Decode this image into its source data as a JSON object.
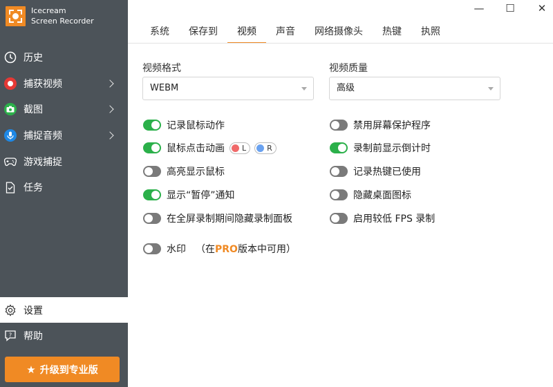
{
  "brand": {
    "line1": "Icecream",
    "line2": "Screen Recorder"
  },
  "sidebar": {
    "items": [
      {
        "label": "历史"
      },
      {
        "label": "捕获视频"
      },
      {
        "label": "截图"
      },
      {
        "label": "捕捉音频"
      },
      {
        "label": "游戏捕捉"
      },
      {
        "label": "任务"
      }
    ],
    "bottom": [
      {
        "label": "设置"
      },
      {
        "label": "帮助"
      }
    ],
    "upgrade_label": "升级到专业版"
  },
  "window": {
    "minimize": "—",
    "maximize": "☐",
    "close": "✕"
  },
  "tabs": [
    {
      "label": "系统"
    },
    {
      "label": "保存到"
    },
    {
      "label": "视频"
    },
    {
      "label": "声音"
    },
    {
      "label": "网络摄像头"
    },
    {
      "label": "热键"
    },
    {
      "label": "执照"
    }
  ],
  "video_format": {
    "label": "视频格式",
    "value": "WEBM"
  },
  "video_quality": {
    "label": "视频质量",
    "value": "高级"
  },
  "left_options": [
    {
      "label": "记录鼠标动作",
      "on": true
    },
    {
      "label": "鼠标点击动画",
      "on": true,
      "left_key": "L",
      "right_key": "R"
    },
    {
      "label": "高亮显示鼠标",
      "on": false
    },
    {
      "label": "显示“暂停”通知",
      "on": true
    },
    {
      "label": "在全屏录制期间隐藏录制面板",
      "on": false
    }
  ],
  "right_options": [
    {
      "label": "禁用屏幕保护程序",
      "on": false
    },
    {
      "label": "录制前显示倒计时",
      "on": true
    },
    {
      "label": "记录热键已使用",
      "on": false
    },
    {
      "label": "隐藏桌面图标",
      "on": false
    },
    {
      "label": "启用较低 FPS 录制",
      "on": false
    }
  ],
  "watermark": {
    "label": "水印",
    "note_pre": "（在",
    "note_pro": "PRO",
    "note_post": "版本中可用）",
    "on": false
  },
  "colors": {
    "accent": "#f08a24",
    "toggle_on": "#2bb04a",
    "toggle_off": "#7a7a7a",
    "sidebar": "#4c5359"
  }
}
